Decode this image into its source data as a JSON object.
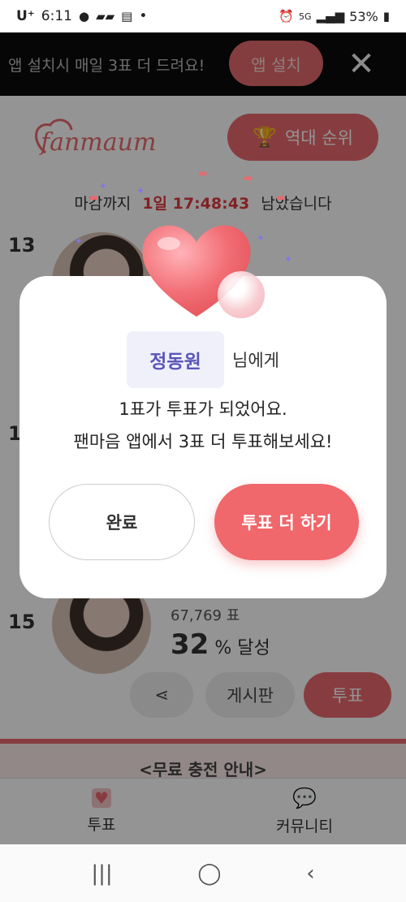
{
  "status_bar": {
    "carrier": "U⁺",
    "time": "6:11",
    "dot": "•",
    "icons_left": [
      "chat-icon",
      "kakao-icon",
      "app-icon"
    ],
    "icons_right": [
      "alarm-icon",
      "5g-icon",
      "signal-icon",
      "battery-icon"
    ],
    "network": "5G",
    "battery": "53%"
  },
  "banner": {
    "text": "앱 설치시 매일 3표 더 드려요!",
    "install_label": "앱 설치",
    "close_label": "✕"
  },
  "header": {
    "logo": "fanmaum",
    "history_label": "역대 순위"
  },
  "deadline": {
    "prefix": "마감까지",
    "timer": "1일 17:48:43",
    "suffix": "남았습니다"
  },
  "ranks": [
    {
      "rank": "13"
    },
    {
      "rank": "1"
    },
    {
      "rank": "15",
      "votes": "67,769 표",
      "percent": "32",
      "percent_suffix": "% 달성"
    }
  ],
  "row_actions": {
    "share_label": "⋖",
    "board_label": "게시판",
    "vote_label": "투표"
  },
  "free_charge": "<무료 충전 안내>",
  "tabs": [
    {
      "label": "투표",
      "icon": "heart-icon"
    },
    {
      "label": "커뮤니티",
      "icon": "speech-bubble-icon"
    }
  ],
  "navbar": {
    "recent": "|||",
    "home": "◯",
    "back": "‹"
  },
  "modal": {
    "name": "정동원",
    "name_suffix": "님에게",
    "line1": "1표가 투표가 되었어요.",
    "line2": "팬마음 앱에서 3표 더 투표해보세요!",
    "done_label": "완료",
    "more_label": "투표 더 하기"
  },
  "colors": {
    "accent": "#f0676c",
    "name_purple": "#5a56b8",
    "timer_red": "#e0393e"
  }
}
